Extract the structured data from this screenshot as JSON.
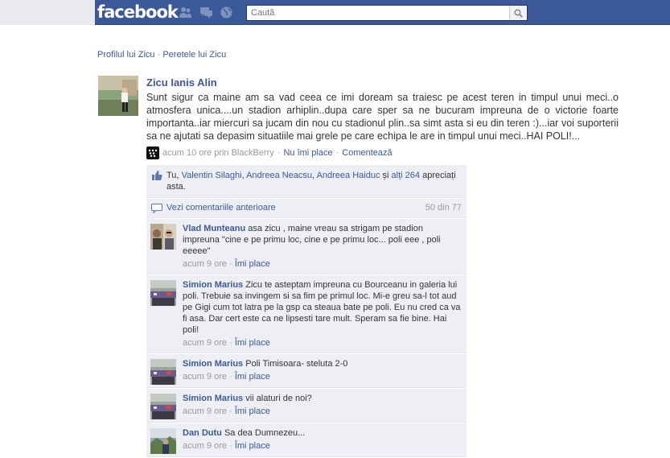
{
  "header": {
    "logo": "facebook",
    "search_placeholder": "Caută"
  },
  "breadcrumb": {
    "profile": "Profilul lui Zicu",
    "separator": "·",
    "wall": "Peretele lui Zicu"
  },
  "post": {
    "author": "Zicu Ianis Alin",
    "text": "Sunt sigur ca maine am sa vad ceea ce imi doream sa traiesc pe acest teren in timpul unui meci..o atmosfera unica....un stadion arhiplin..dupa care sper sa ne bucuram impreuna de o victorie foarte importanta..iar miercuri sa jucam din nou cu stadionul plin..sa simt asta si eu din teren :)...iar voi suporterii sa ne ajutati sa depasim situatiile mai grele pe care echipa le are in timpul unui meci..HAI POLI!...",
    "time": "acum 10 ore prin BlackBerry",
    "sep": "·",
    "unlike": "Nu îmi place",
    "comment": "Comentează"
  },
  "likes": {
    "you": "Tu,",
    "people": [
      "Valentin Silaghi",
      "Andreea Neacsu",
      "Andreea Haiduc"
    ],
    "and": "și",
    "others": "alți 264",
    "tail": "apreciați asta."
  },
  "previous": {
    "label": "Vezi comentariile anterioare",
    "count": "50 din 77"
  },
  "comments": [
    {
      "name": "Vlad Munteanu",
      "text": "asa zicu , maine vreau sa strigam pe stadion impreuna \"cine e pe primu loc, cine e pe primu loc... poli eee , poli eeeee\"",
      "time": "acum 9 ore",
      "sep": "·",
      "like": "Îmi place"
    },
    {
      "name": "Simion Marius",
      "text": "Zicu te asteptam impreuna cu Bourceanu in galeria lui poli. Trebuie sa invingem si sa fim pe primul loc. Mi-e greu sa-l tot aud pe Gigi cum tot latra pe la gsp ca steaua bate pe poli. Eu nu cred ca va fi asa. Dar cert este ca ne lipsesti tare mult. Speram sa fie bine. Hai poli!",
      "time": "acum 9 ore",
      "sep": "·",
      "like": "Îmi place"
    },
    {
      "name": "Simion Marius",
      "text": "Poli Timisoara- steluta 2-0",
      "time": "acum 9 ore",
      "sep": "·",
      "like": "Îmi place"
    },
    {
      "name": "Simion Marius",
      "text": "vii alaturi de noi?",
      "time": "acum 9 ore",
      "sep": "·",
      "like": "Îmi place"
    },
    {
      "name": "Dan Dutu",
      "text": "Sa dea Dumnezeu...",
      "time": "acum 9 ore",
      "sep": "·",
      "like": "Îmi place"
    }
  ],
  "colors": {
    "brand_blue": "#3b5998",
    "feedback_bg": "#edeff4"
  }
}
